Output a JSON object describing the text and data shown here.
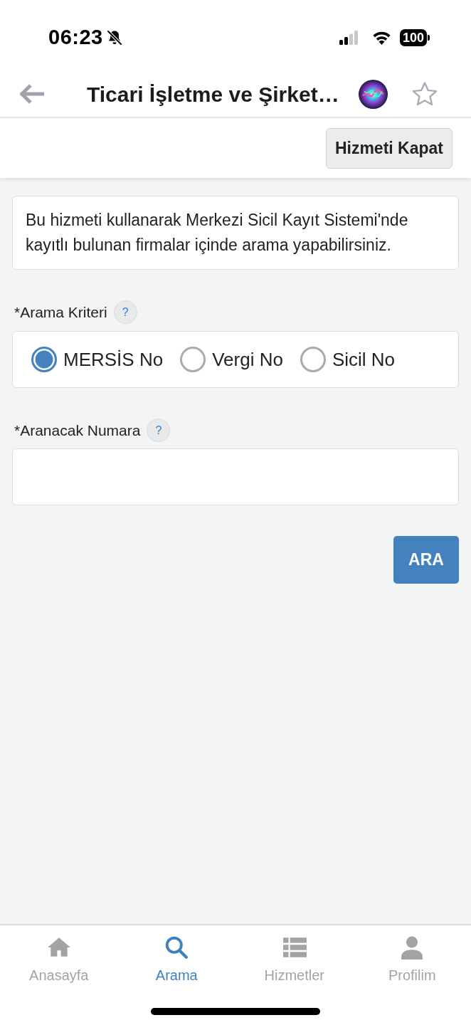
{
  "status_bar": {
    "time": "06:23",
    "battery": "100"
  },
  "nav": {
    "title": "Ticari İşletme ve Şirket…"
  },
  "toolbar": {
    "close_button": "Hizmeti Kapat"
  },
  "info": "Bu hizmeti kullanarak Merkezi Sicil Kayıt Sistemi'nde kayıtlı bulunan firmalar içinde arama yapabilirsiniz.",
  "criteria": {
    "label": "*Arama Kriteri",
    "help": "?",
    "options": [
      {
        "label": "MERSİS No",
        "selected": true
      },
      {
        "label": "Vergi No",
        "selected": false
      },
      {
        "label": "Sicil No",
        "selected": false
      }
    ]
  },
  "number": {
    "label": "*Aranacak Numara",
    "help": "?"
  },
  "search_button": "ARA",
  "tab_bar": [
    {
      "kind": "home",
      "label": "Anasayfa",
      "selected": false
    },
    {
      "kind": "search",
      "label": "Arama",
      "selected": true
    },
    {
      "kind": "list",
      "label": "Hizmetler",
      "selected": false
    },
    {
      "kind": "person",
      "label": "Profilim",
      "selected": false
    }
  ]
}
